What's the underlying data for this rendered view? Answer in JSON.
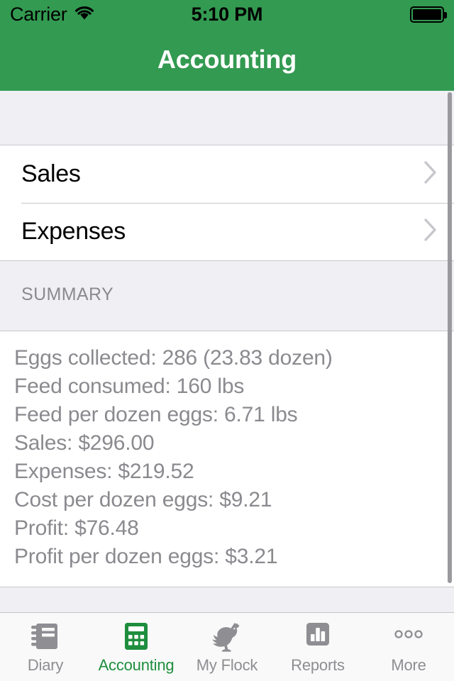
{
  "status_bar": {
    "carrier": "Carrier",
    "wifi_icon": "wifi-icon",
    "time": "5:10 PM",
    "battery_icon": "battery-full-icon"
  },
  "nav": {
    "title": "Accounting"
  },
  "colors": {
    "header_green": "#339A51",
    "accent_green": "#1E8E3E",
    "group_background": "#EFEFF4",
    "separator": "#C8C7CC",
    "secondary_text": "#8A8A8F",
    "tab_inactive": "#8E8E93"
  },
  "list": {
    "rows": [
      {
        "label": "Sales",
        "accessory": "chevron-right-icon"
      },
      {
        "label": "Expenses",
        "accessory": "chevron-right-icon"
      }
    ]
  },
  "summary": {
    "header": "SUMMARY",
    "lines": [
      "Eggs collected:  286  (23.83 dozen)",
      "Feed consumed:  160 lbs",
      "Feed per dozen eggs:  6.71 lbs",
      "Sales:  $296.00",
      "Expenses:  $219.52",
      "Cost per dozen eggs:  $9.21",
      "Profit:  $76.48",
      "Profit per dozen eggs:  $3.21"
    ],
    "values": {
      "eggs_collected": 286,
      "eggs_collected_dozen": 23.83,
      "feed_consumed_lbs": 160,
      "feed_per_dozen_eggs_lbs": 6.71,
      "sales": 296.0,
      "expenses": 219.52,
      "cost_per_dozen_eggs": 9.21,
      "profit": 76.48,
      "profit_per_dozen_eggs": 3.21
    }
  },
  "tab_bar": {
    "items": [
      {
        "label": "Diary",
        "icon": "notebook-icon",
        "selected": false
      },
      {
        "label": "Accounting",
        "icon": "calculator-icon",
        "selected": true
      },
      {
        "label": "My Flock",
        "icon": "chicken-icon",
        "selected": false
      },
      {
        "label": "Reports",
        "icon": "bar-chart-icon",
        "selected": false
      },
      {
        "label": "More",
        "icon": "ellipsis-icon",
        "selected": false
      }
    ]
  }
}
